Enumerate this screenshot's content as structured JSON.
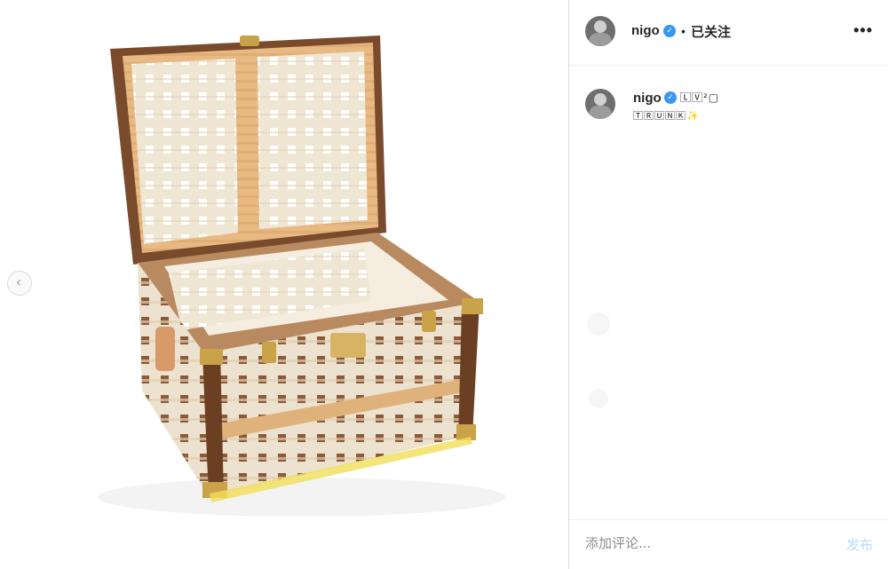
{
  "post": {
    "user": {
      "username": "nigo",
      "verified_icon": "verified-badge-icon",
      "follow_state": "已关注"
    },
    "header_dot": "•",
    "more_label": "•••",
    "caption": {
      "line1": "🄻🅅²▢",
      "line2": "🅃🅁🅄🄽🄺",
      "sparkle": "✨"
    },
    "image": {
      "subject": "woven trunk icon",
      "prev_arrow": "‹"
    },
    "comment": {
      "placeholder": "添加评论...",
      "post_label": "发布"
    },
    "colors": {
      "verified": "#3897f0",
      "post_disabled": "#b3dbff"
    }
  }
}
